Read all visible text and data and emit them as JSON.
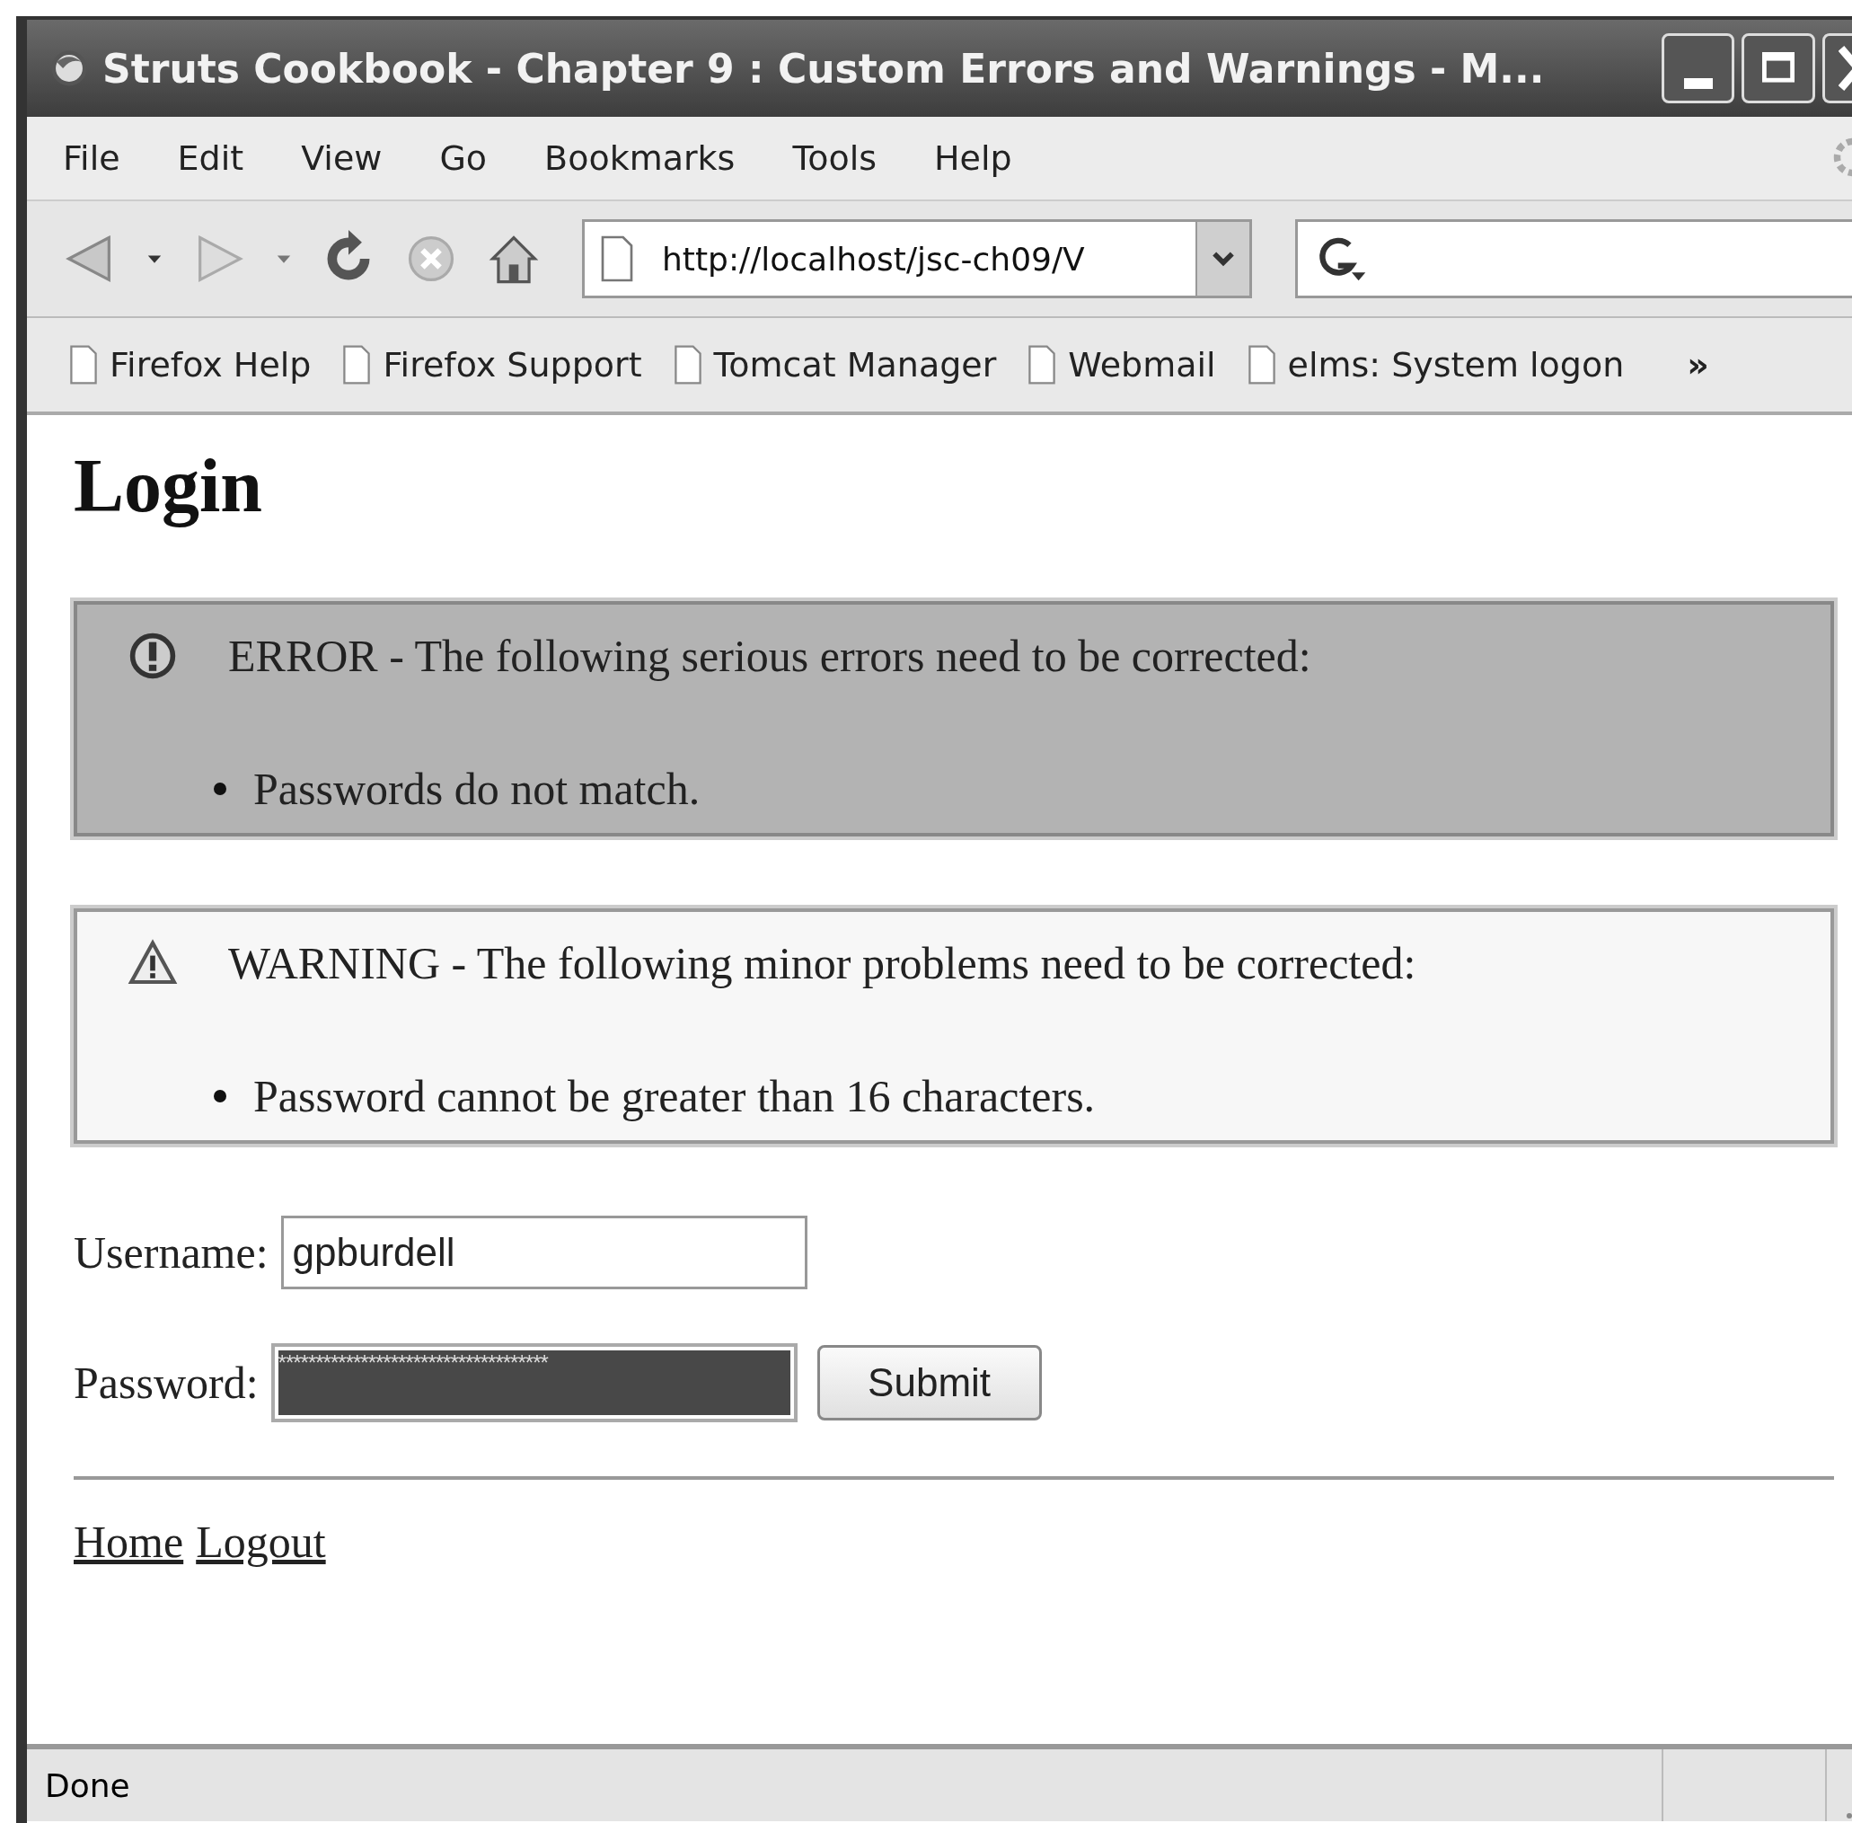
{
  "window": {
    "title": "Struts Cookbook - Chapter 9 : Custom Errors and Warnings - M..."
  },
  "menu": [
    "File",
    "Edit",
    "View",
    "Go",
    "Bookmarks",
    "Tools",
    "Help"
  ],
  "address_bar": {
    "value": "http://localhost/jsc-ch09/V"
  },
  "bookmarks": [
    "Firefox Help",
    "Firefox Support",
    "Tomcat Manager",
    "Webmail",
    "elms: System logon"
  ],
  "bookmarks_overflow": "»",
  "page": {
    "heading": "Login",
    "messages": [
      {
        "kind": "error",
        "title": "ERROR - The following serious errors need to be corrected:",
        "items": [
          "Passwords do not match."
        ]
      },
      {
        "kind": "warning",
        "title": "WARNING - The following minor problems need to be corrected:",
        "items": [
          "Password cannot be greater than 16 characters."
        ]
      }
    ],
    "form": {
      "username_label": "Username:",
      "username_value": "gpburdell",
      "password_label": "Password:",
      "password_value": "************************************",
      "submit": "Submit"
    },
    "links": [
      "Home",
      "Logout"
    ]
  },
  "status_bar": {
    "text": "Done"
  }
}
